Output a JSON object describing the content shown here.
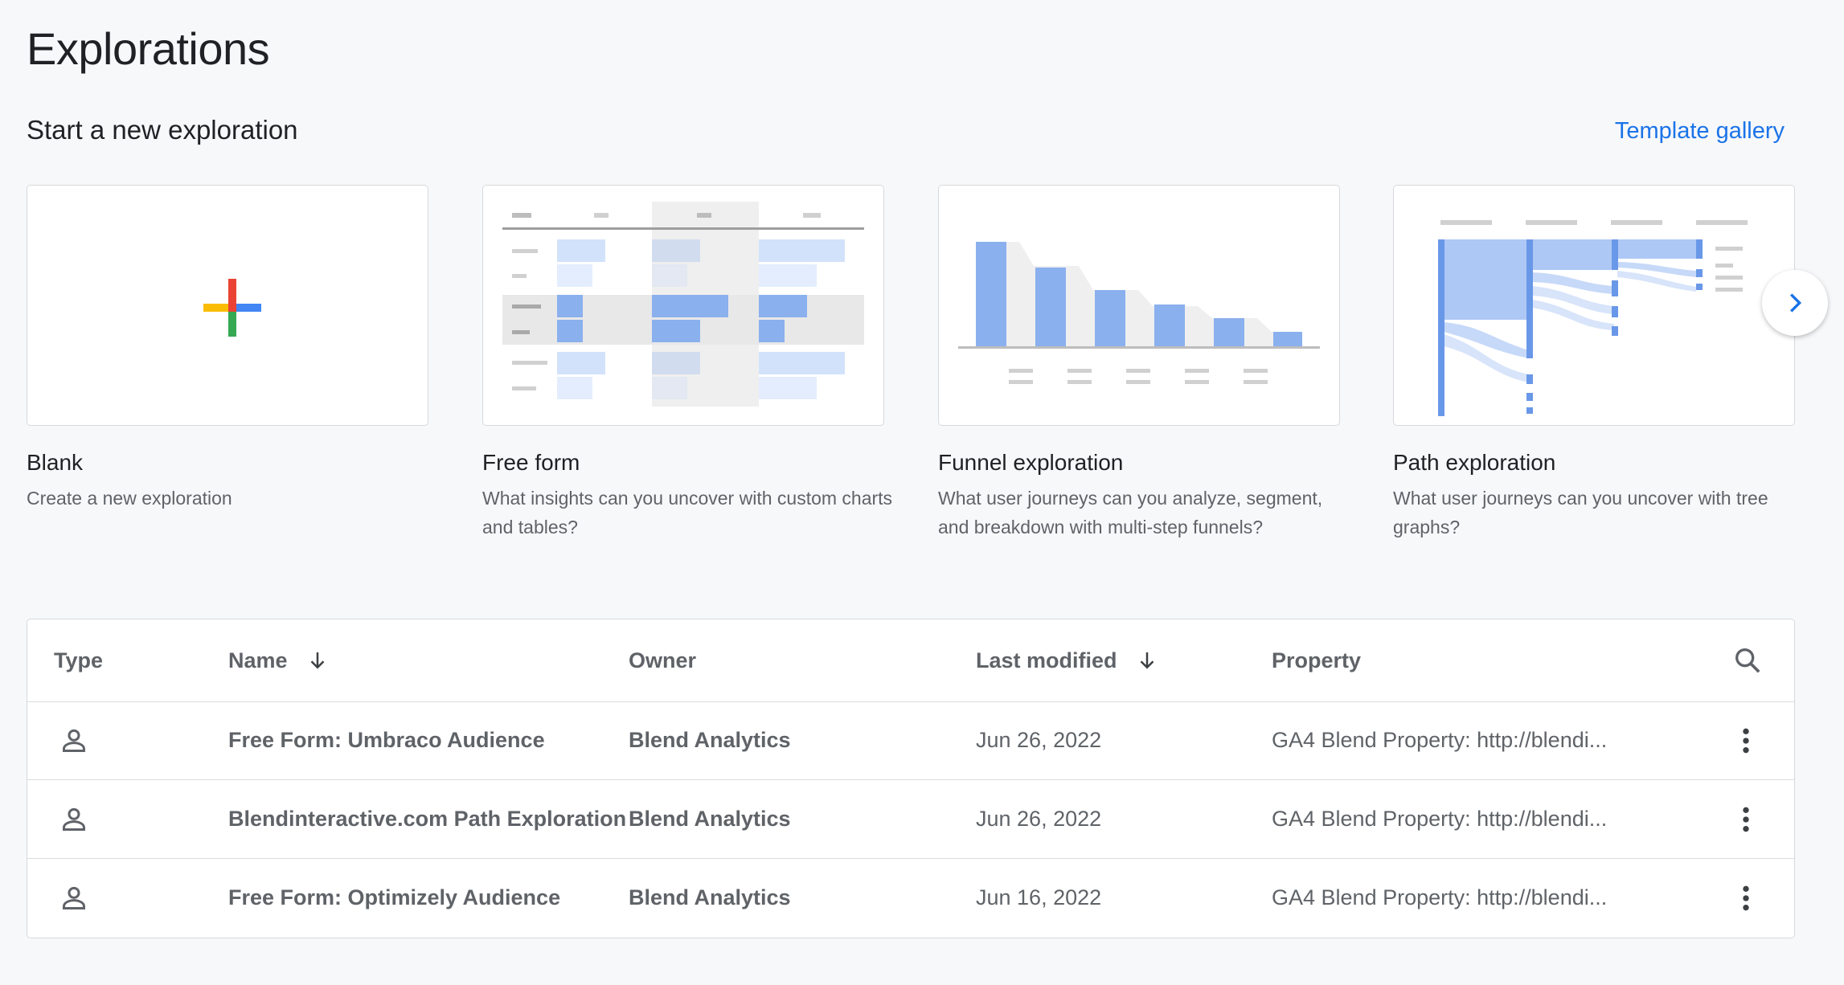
{
  "page": {
    "title": "Explorations"
  },
  "new_section": {
    "title": "Start a new exploration",
    "gallery_link": "Template gallery"
  },
  "templates": [
    {
      "title": "Blank",
      "description": "Create a new exploration"
    },
    {
      "title": "Free form",
      "description": "What insights can you uncover with custom charts and tables?"
    },
    {
      "title": "Funnel exploration",
      "description": "What user journeys can you analyze, segment, and breakdown with multi-step funnels?"
    },
    {
      "title": "Path exploration",
      "description": "What user journeys can you uncover with tree graphs?"
    }
  ],
  "table": {
    "headers": {
      "type": "Type",
      "name": "Name",
      "owner": "Owner",
      "last_modified": "Last modified",
      "property": "Property"
    },
    "rows": [
      {
        "name": "Free Form: Umbraco Audience",
        "owner": "Blend Analytics",
        "last_modified": "Jun 26, 2022",
        "property": "GA4 Blend Property: http://blendi..."
      },
      {
        "name": "Blendinteractive.com Path Exploration",
        "owner": "Blend Analytics",
        "last_modified": "Jun 26, 2022",
        "property": "GA4 Blend Property: http://blendi..."
      },
      {
        "name": "Free Form: Optimizely Audience",
        "owner": "Blend Analytics",
        "last_modified": "Jun 16, 2022",
        "property": "GA4 Blend Property: http://blendi..."
      }
    ]
  },
  "icons": {
    "sort": "arrow-down-icon",
    "search": "search-icon",
    "row_type": "person-icon",
    "row_menu": "more-vert-icon",
    "next": "chevron-right-icon"
  },
  "colors": {
    "accent": "#1a73e8",
    "thumb_blue": "#8ab0ee",
    "thumb_light": "#d2e2fb",
    "google_red": "#ea4335",
    "google_yellow": "#fbbc04",
    "google_green": "#34a853",
    "google_blue": "#4285f4"
  }
}
